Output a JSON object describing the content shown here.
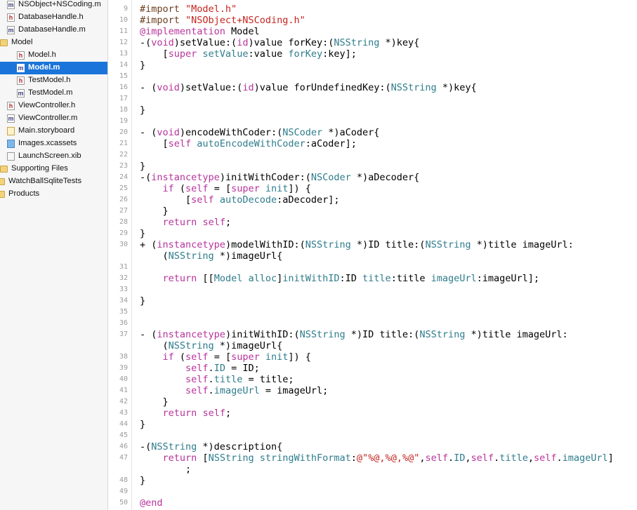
{
  "navigator": {
    "items": [
      {
        "label": "NSObject+NSCoding.m",
        "icon": "m-file-icon",
        "indent": 1,
        "selected": false
      },
      {
        "label": "DatabaseHandle.h",
        "icon": "h-file-icon",
        "indent": 1,
        "selected": false
      },
      {
        "label": "DatabaseHandle.m",
        "icon": "m-file-icon",
        "indent": 1,
        "selected": false
      },
      {
        "label": "Model",
        "icon": "folder-icon",
        "indent": 0,
        "selected": false
      },
      {
        "label": "Model.h",
        "icon": "h-file-icon",
        "indent": 2,
        "selected": false
      },
      {
        "label": "Model.m",
        "icon": "m-file-icon",
        "indent": 2,
        "selected": true
      },
      {
        "label": "TestModel.h",
        "icon": "h-file-icon",
        "indent": 2,
        "selected": false
      },
      {
        "label": "TestModel.m",
        "icon": "m-file-icon",
        "indent": 2,
        "selected": false
      },
      {
        "label": "ViewController.h",
        "icon": "h-file-icon",
        "indent": 1,
        "selected": false
      },
      {
        "label": "ViewController.m",
        "icon": "m-file-icon",
        "indent": 1,
        "selected": false
      },
      {
        "label": "Main.storyboard",
        "icon": "storyboard-icon",
        "indent": 1,
        "selected": false
      },
      {
        "label": "Images.xcassets",
        "icon": "assets-icon",
        "indent": 1,
        "selected": false
      },
      {
        "label": "LaunchScreen.xib",
        "icon": "xib-icon",
        "indent": 1,
        "selected": false
      },
      {
        "label": "Supporting Files",
        "icon": "folder-icon",
        "indent": 0,
        "selected": false
      },
      {
        "label": "WatchBallSqliteTests",
        "icon": "folder-icon",
        "indent": -1,
        "selected": false
      },
      {
        "label": "Products",
        "icon": "folder-icon",
        "indent": -1,
        "selected": false
      }
    ]
  },
  "editor": {
    "line_numbers": [
      "9",
      "10",
      "11",
      "12",
      "13",
      "14",
      "15",
      "16",
      "17",
      "18",
      "19",
      "20",
      "21",
      "22",
      "23",
      "24",
      "25",
      "26",
      "27",
      "28",
      "29",
      "30",
      "31",
      "32",
      "33",
      "34",
      "35",
      "36",
      "37",
      "38",
      "39",
      "40",
      "41",
      "42",
      "43",
      "44",
      "45",
      "46",
      "47",
      "48",
      "49",
      "50"
    ],
    "lines": [
      "<span class=\"pre\">#import </span><span class=\"str\">\"Model.h\"</span>",
      "<span class=\"pre\">#import </span><span class=\"str\">\"NSObject+NSCoding.h\"</span>",
      "<span class=\"kw\">@implementation</span> Model",
      "-(<span class=\"kw\">void</span>)setValue:(<span class=\"kw\">id</span>)value forKey:(<span class=\"cls\">NSString</span> *)key{",
      "    [<span class=\"kw\">super</span> <span class=\"mth\">setValue</span>:value <span class=\"mth\">forKey</span>:key];",
      "}",
      "",
      "- (<span class=\"kw\">void</span>)setValue:(<span class=\"kw\">id</span>)value forUndefinedKey:(<span class=\"cls\">NSString</span> *)key{",
      "",
      "}",
      "",
      "- (<span class=\"kw\">void</span>)encodeWithCoder:(<span class=\"cls\">NSCoder</span> *)aCoder{",
      "    [<span class=\"kw\">self</span> <span class=\"mth\">autoEncodeWithCoder</span>:aCoder];",
      "",
      "}",
      "-(<span class=\"kw\">instancetype</span>)initWithCoder:(<span class=\"cls\">NSCoder</span> *)aDecoder{",
      "    <span class=\"kw\">if</span> (<span class=\"kw\">self</span> = [<span class=\"kw\">super</span> <span class=\"mth\">init</span>]) {",
      "        [<span class=\"kw\">self</span> <span class=\"mth\">autoDecode</span>:aDecoder];",
      "    }",
      "    <span class=\"kw\">return</span> <span class=\"kw\">self</span>;",
      "}",
      "+ (<span class=\"kw\">instancetype</span>)modelWithID:(<span class=\"cls\">NSString</span> *)ID title:(<span class=\"cls\">NSString</span> *)title imageUrl:",
      "    (<span class=\"cls\">NSString</span> *)imageUrl{",
      "",
      "    <span class=\"kw\">return</span> [[<span class=\"cls\">Model</span> <span class=\"mth\">alloc</span>]<span class=\"mth\">initWithID</span>:ID <span class=\"mth\">title</span>:title <span class=\"mth\">imageUrl</span>:imageUrl];",
      "",
      "}",
      "",
      "",
      "- (<span class=\"kw\">instancetype</span>)initWithID:(<span class=\"cls\">NSString</span> *)ID title:(<span class=\"cls\">NSString</span> *)title imageUrl:",
      "    (<span class=\"cls\">NSString</span> *)imageUrl{",
      "    <span class=\"kw\">if</span> (<span class=\"kw\">self</span> = [<span class=\"kw\">super</span> <span class=\"mth\">init</span>]) {",
      "        <span class=\"kw\">self</span>.<span class=\"mth\">ID</span> = ID;",
      "        <span class=\"kw\">self</span>.<span class=\"mth\">title</span> = title;",
      "        <span class=\"kw\">self</span>.<span class=\"mth\">imageUrl</span> = imageUrl;",
      "    }",
      "    <span class=\"kw\">return</span> <span class=\"kw\">self</span>;",
      "}",
      "",
      "-(<span class=\"cls\">NSString</span> *)description{",
      "    <span class=\"kw\">return</span> [<span class=\"cls\">NSString</span> <span class=\"mth\">stringWithFormat</span>:<span class=\"str\">@\"%@,%@,%@\"</span>,<span class=\"kw\">self</span>.<span class=\"mth\">ID</span>,<span class=\"kw\">self</span>.<span class=\"mth\">title</span>,<span class=\"kw\">self</span>.<span class=\"mth\">imageUrl</span>]",
      "        ;",
      "}",
      "",
      "<span class=\"kw\">@end</span>",
      ""
    ]
  },
  "colors": {
    "selection": "#1b74d9",
    "keyword": "#b8339b",
    "class": "#2e7c8c",
    "string": "#c4251f"
  }
}
